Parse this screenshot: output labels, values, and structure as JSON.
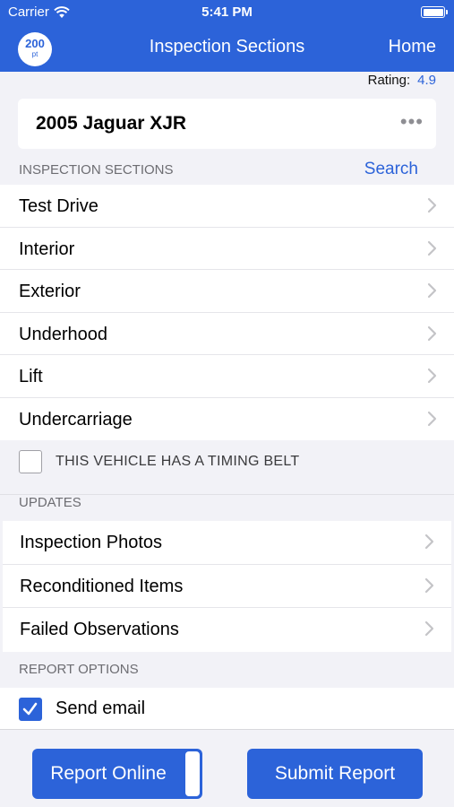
{
  "status_bar": {
    "carrier": "Carrier",
    "time": "5:41 PM"
  },
  "nav": {
    "logo_top": "200",
    "logo_bottom": "pt",
    "title": "Inspection Sections",
    "home": "Home"
  },
  "rating": {
    "label": "Rating:",
    "value": "4.9"
  },
  "vehicle": {
    "name": "2005 Jaguar XJR",
    "more": "•••"
  },
  "inspection_sections": {
    "header": "INSPECTION SECTIONS",
    "search": "Search",
    "items": [
      "Test Drive",
      "Interior",
      "Exterior",
      "Underhood",
      "Lift",
      "Undercarriage"
    ]
  },
  "timing_belt": {
    "label": "THIS VEHICLE HAS A TIMING BELT",
    "checked": false
  },
  "updates": {
    "header": "UPDATES",
    "items": [
      "Inspection Photos",
      "Reconditioned Items",
      "Failed Observations"
    ]
  },
  "report_options": {
    "header": "REPORT OPTIONS",
    "send_email_label": "Send email",
    "send_email_checked": true
  },
  "buttons": {
    "report_online": "Report Online",
    "submit_report": "Submit Report"
  },
  "colors": {
    "accent": "#2c63d9",
    "background": "#f2f2f7"
  }
}
